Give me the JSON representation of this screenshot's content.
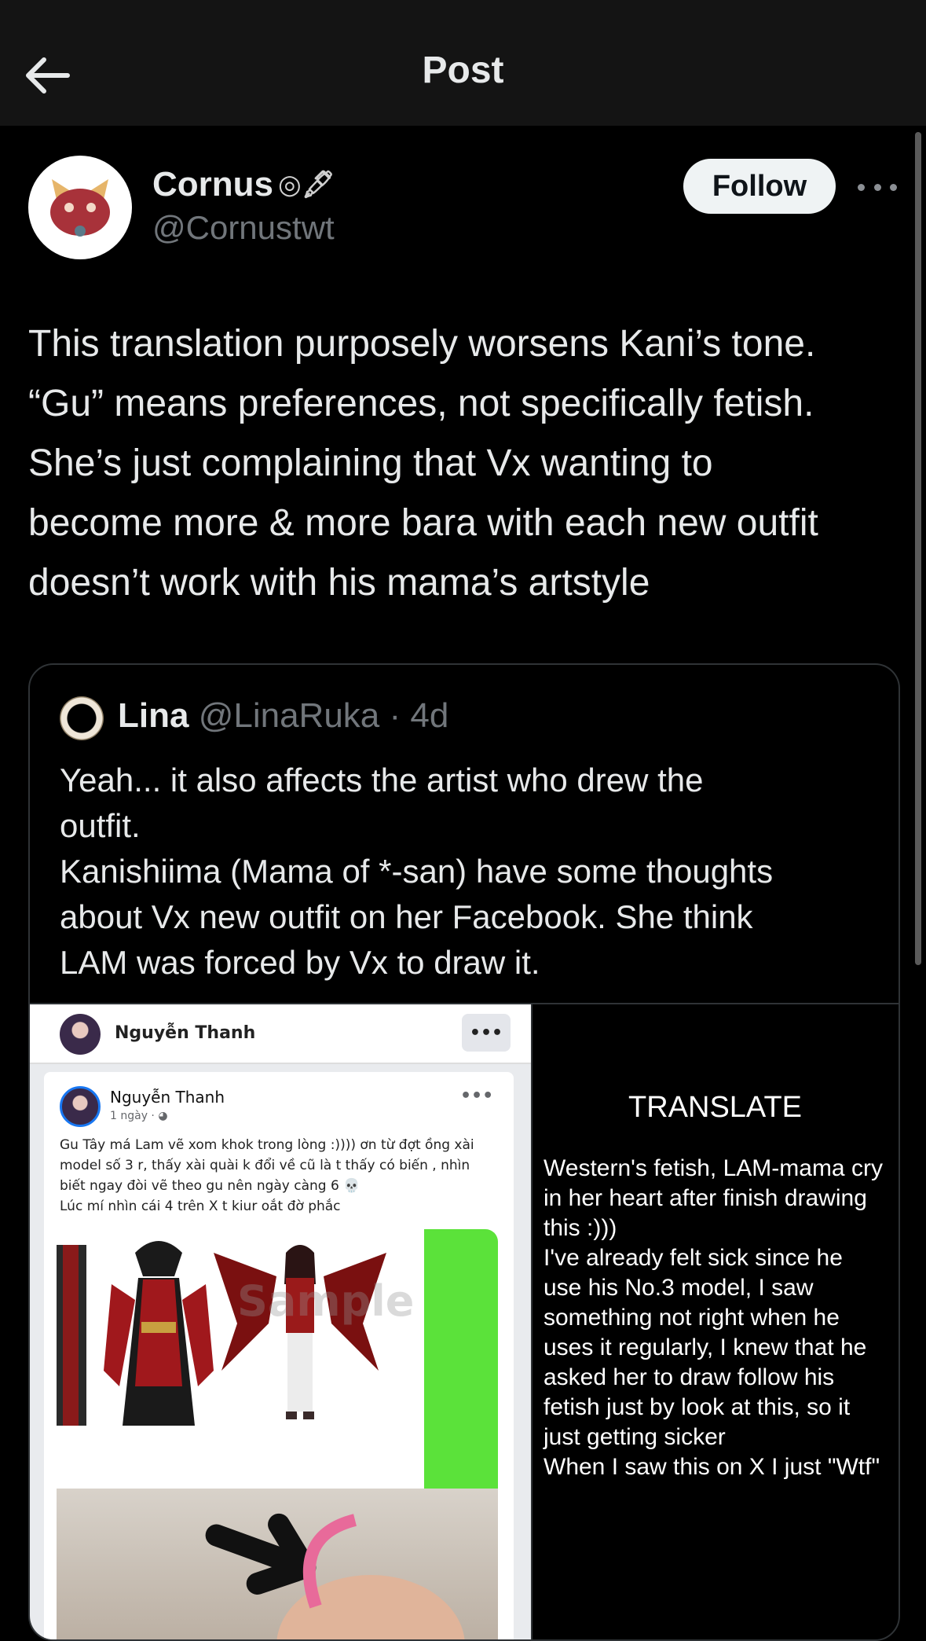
{
  "header": {
    "title": "Post"
  },
  "author": {
    "name": "Cornus",
    "name_icons": "◎🖋",
    "handle": "@Cornustwt",
    "follow_label": "Follow"
  },
  "post": {
    "text": "This translation purposely worsens Kani’s tone.\n“Gu” means preferences, not specifically fetish.\nShe’s just complaining that Vx wanting to\nbecome more & more bara with each new outfit\ndoesn’t work with his mama’s artstyle"
  },
  "quote": {
    "name": "Lina",
    "meta": "@LinaRuka · 4d",
    "text": "Yeah... it also affects the artist who drew the\noutfit.\nKanishiima (Mama of *-san) have some thoughts\nabout Vx new outfit on her Facebook. She think\nLAM was forced by Vx to draw it.",
    "image": {
      "page_name": "Nguyễn Thanh",
      "post_name": "Nguyễn Thanh",
      "post_time": "1 ngày · ◕",
      "more": "•••",
      "post_text": "Gu Tây má Lam vẽ xom khok trong lòng :)))) ơn từ đợt ồng xài\nmodel số 3 r, thấy xài quài k đổi về cũ là t thấy có biến , nhìn\nbiết ngay đòi vẽ theo gu nên ngày càng 6 💀\nLúc mí nhìn cái 4 trên X t kiur oắt đờ phắc",
      "watermark": "Sample",
      "translate_title": "TRANSLATE",
      "translate_text": "Western's fetish, LAM-mama cry\nin her heart after finish drawing\nthis :)))\nI've already felt sick since he\nuse his No.3 model, I saw\nsomething not right when he\nuses it regularly, I knew that he\nasked her to draw follow his\nfetish just by look at this, so it\njust getting sicker\nWhen I saw this on X I just \"Wtf\""
    }
  },
  "colors": {
    "background": "#000000",
    "topbar": "#141414",
    "text": "#e7e9ea",
    "muted": "#71767b",
    "border": "#2f3336",
    "follow_bg": "#eff3f4"
  },
  "icons": {
    "back": "arrow-left-icon",
    "more": "more-horizontal-icon"
  }
}
